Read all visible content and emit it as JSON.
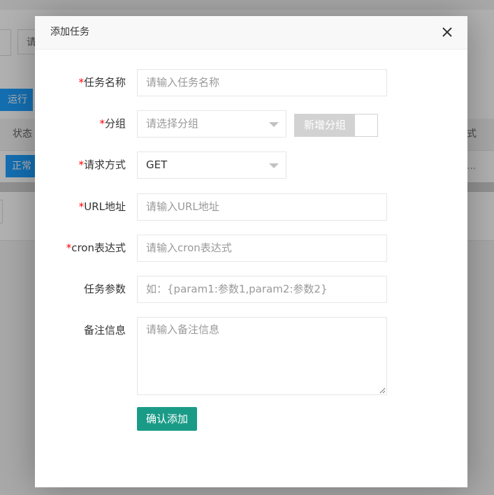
{
  "background": {
    "search_placeholder_partial": "请",
    "run_button_partial": "运行",
    "table_header_status_partial": "状态",
    "table_header_right_partial": "式",
    "status_badge_partial": "正常",
    "row_right_partial": "..."
  },
  "modal": {
    "title": "添加任务",
    "close_icon": "close-icon",
    "fields": {
      "task_name": {
        "required_mark": "*",
        "label": "任务名称",
        "placeholder": "请输入任务名称"
      },
      "group": {
        "required_mark": "*",
        "label": "分组",
        "placeholder": "请选择分组",
        "switch_label": "新增分组"
      },
      "method": {
        "required_mark": "*",
        "label": "请求方式",
        "value": "GET"
      },
      "url": {
        "required_mark": "*",
        "label": "URL地址",
        "placeholder": "请输入URL地址"
      },
      "cron": {
        "required_mark": "*",
        "label": "cron表达式",
        "placeholder": "请输入cron表达式"
      },
      "params": {
        "label": "任务参数",
        "placeholder": "如：{param1:参数1,param2:参数2}"
      },
      "remark": {
        "label": "备注信息",
        "placeholder": "请输入备注信息"
      }
    },
    "submit_label": "确认添加"
  },
  "colors": {
    "required": "#ff0000",
    "submit": "#1a9b87",
    "switch_off": "#d2d2d2",
    "background_button": "#1e9fff"
  }
}
